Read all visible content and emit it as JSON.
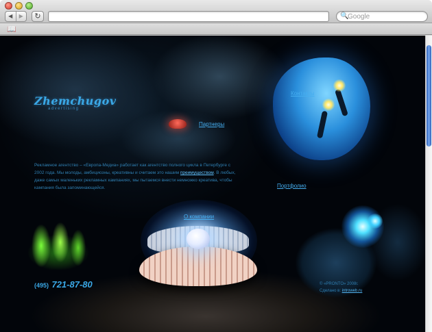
{
  "browser": {
    "url": "",
    "search_placeholder": "Google",
    "back_icon": "◀",
    "forward_icon": "▶",
    "reload_icon": "↻",
    "bookmarks_icon": "📖"
  },
  "page": {
    "logo": "Zhemchugov",
    "logo_tagline": "advertising",
    "nav": {
      "contacts": "Контакты",
      "partners": "Партнеры",
      "portfolio": "Портфолио",
      "about_company": "О компании"
    },
    "about": {
      "text_part1": "Рекламное агентство – «Европа-Медиа» работает как агентство полного цикла в Петербурге с 2002 года. Мы молоды, амбициозны, креативны и считаем это нашим",
      "link": "преимуществом",
      "text_part2": ". В любых, даже самых маленьких рекламных кампаниях, мы пытаемся внести немножко креатива, чтобы кампания была запоминающейся."
    },
    "phone": {
      "code": "(495)",
      "number": "721-87-80"
    },
    "copyright": {
      "line1": "© «PRONTO» 2008г.",
      "line2_prefix": "Сделано в:",
      "line2_link": "introweb.ru"
    }
  },
  "colors": {
    "accent": "#45aef0",
    "background": "#02050a",
    "scroll_thumb": "#3b72c8"
  }
}
